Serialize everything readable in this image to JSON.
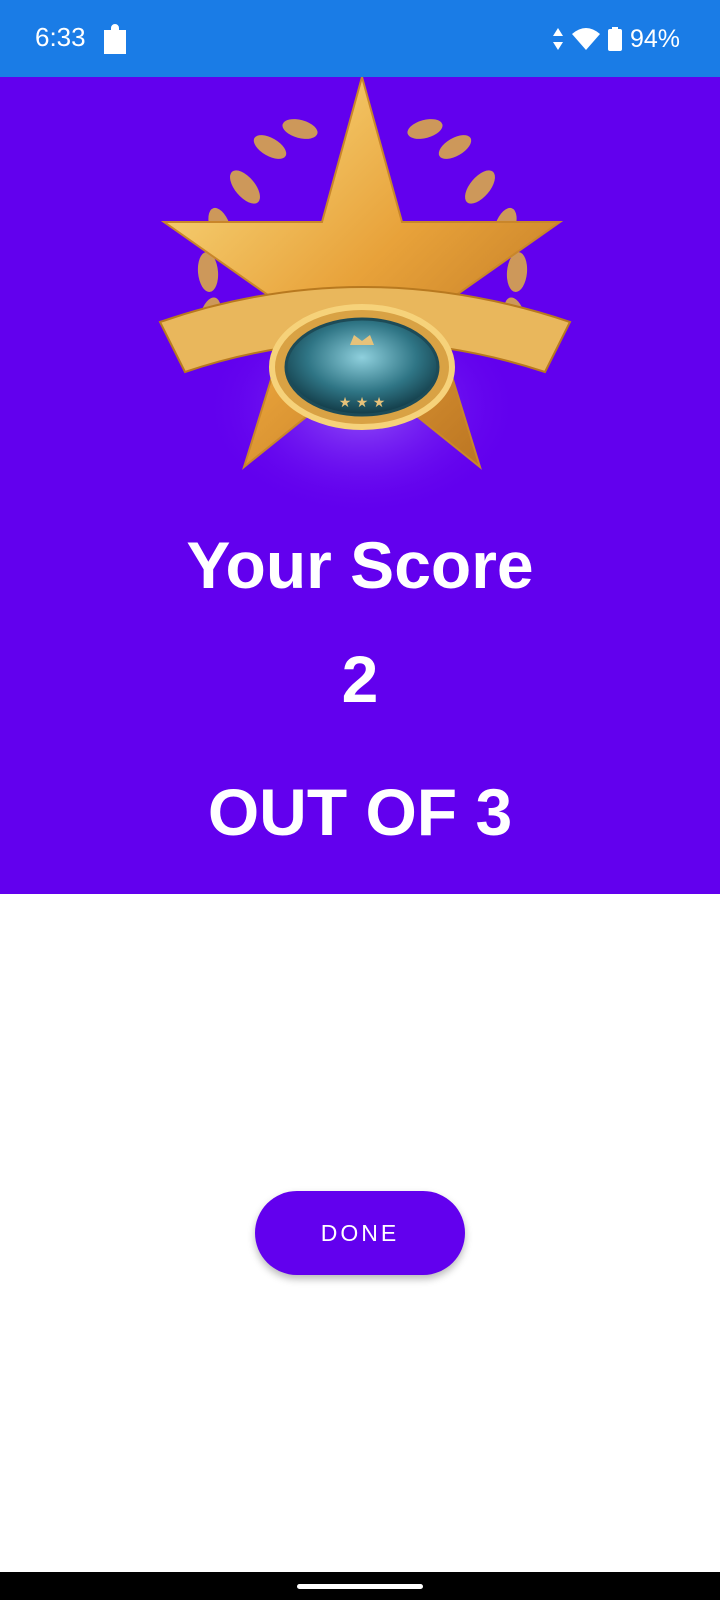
{
  "status_bar": {
    "time": "6:33",
    "battery_percent": "94%",
    "icons": [
      "puzzle-icon",
      "data-arrows-icon",
      "wifi-icon",
      "battery-icon"
    ]
  },
  "result": {
    "title": "Your Score",
    "score": "2",
    "total": "OUT OF 3"
  },
  "actions": {
    "done_label": "DONE"
  },
  "colors": {
    "status_bar": "#1a7ce6",
    "primary": "#6200ee",
    "background": "#ffffff",
    "gold": "#e8a23a"
  }
}
